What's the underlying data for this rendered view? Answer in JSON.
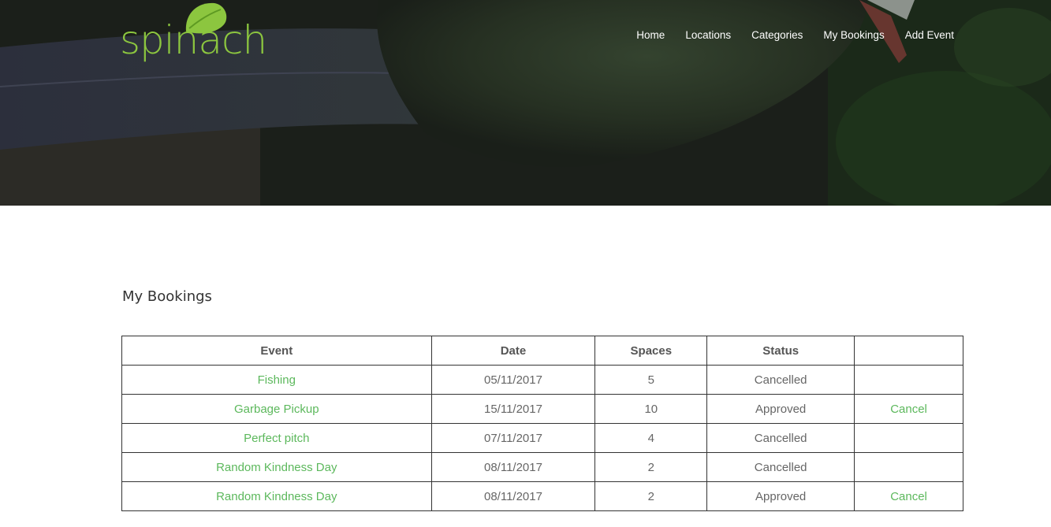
{
  "brand": {
    "name": "spinach",
    "color": "#8cc63f"
  },
  "nav": {
    "items": [
      {
        "label": "Home"
      },
      {
        "label": "Locations"
      },
      {
        "label": "Categories"
      },
      {
        "label": "My Bookings"
      },
      {
        "label": "Add Event"
      }
    ]
  },
  "main": {
    "title": "My Bookings",
    "table": {
      "headers": [
        "Event",
        "Date",
        "Spaces",
        "Status",
        ""
      ],
      "rows": [
        {
          "event": "Fishing",
          "date": "05/11/2017",
          "spaces": "5",
          "status": "Cancelled",
          "action": ""
        },
        {
          "event": "Garbage Pickup",
          "date": "15/11/2017",
          "spaces": "10",
          "status": "Approved",
          "action": "Cancel"
        },
        {
          "event": "Perfect pitch",
          "date": "07/11/2017",
          "spaces": "4",
          "status": "Cancelled",
          "action": ""
        },
        {
          "event": "Random Kindness Day",
          "date": "08/11/2017",
          "spaces": "2",
          "status": "Cancelled",
          "action": ""
        },
        {
          "event": "Random Kindness Day",
          "date": "08/11/2017",
          "spaces": "2",
          "status": "Approved",
          "action": "Cancel"
        }
      ]
    }
  },
  "colors": {
    "link": "#5cb85c",
    "text": "#666666",
    "border": "#333333"
  }
}
